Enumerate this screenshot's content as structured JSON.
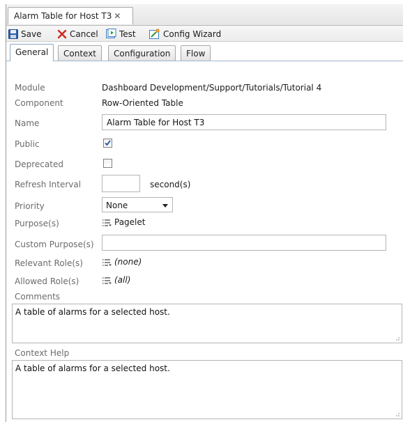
{
  "editor_tab": {
    "title": "Alarm Table for Host T3",
    "close_glyph": "✕"
  },
  "toolbar": {
    "save": "Save",
    "cancel": "Cancel",
    "test": "Test",
    "config_wizard": "Config Wizard"
  },
  "tabs": [
    "General",
    "Context",
    "Configuration",
    "Flow"
  ],
  "active_tab": "General",
  "form": {
    "module": {
      "label": "Module",
      "value": "Dashboard Development/Support/Tutorials/Tutorial 4"
    },
    "component": {
      "label": "Component",
      "value": "Row-Oriented Table"
    },
    "name": {
      "label": "Name",
      "value": "Alarm Table for Host T3"
    },
    "public": {
      "label": "Public",
      "checked": true
    },
    "deprecated": {
      "label": "Deprecated",
      "checked": false
    },
    "refresh_interval": {
      "label": "Refresh Interval",
      "value": "",
      "unit": "second(s)"
    },
    "priority": {
      "label": "Priority",
      "value": "None"
    },
    "purposes": {
      "label": "Purpose(s)",
      "value": "Pagelet"
    },
    "custom_purposes": {
      "label": "Custom Purpose(s)",
      "value": ""
    },
    "relevant_roles": {
      "label": "Relevant Role(s)",
      "value": "(none)"
    },
    "allowed_roles": {
      "label": "Allowed Role(s)",
      "value": "(all)"
    },
    "comments": {
      "label": "Comments",
      "value": "A table of alarms for a selected host."
    },
    "context_help": {
      "label": "Context Help",
      "value": "A table of alarms for a selected host."
    }
  },
  "colors": {
    "accent_check": "#2a5db0",
    "cancel_red": "#d0271d",
    "save_blue": "#2b5fa8"
  }
}
